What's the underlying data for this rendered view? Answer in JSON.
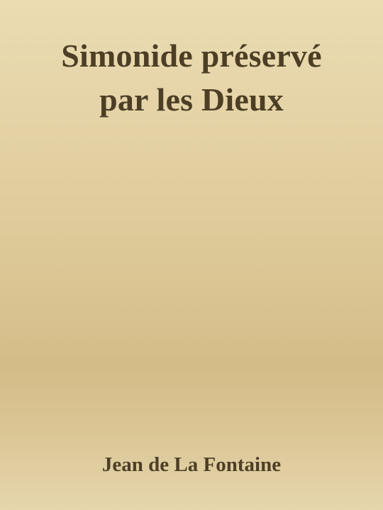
{
  "book": {
    "title_lines": [
      "Simonide préservé",
      "par les Dieux"
    ],
    "author": "Jean de La Fontaine"
  },
  "colors": {
    "background_top": "#ebdcb3",
    "background_mid": "#d4bc87",
    "text": "#4d3f26"
  }
}
